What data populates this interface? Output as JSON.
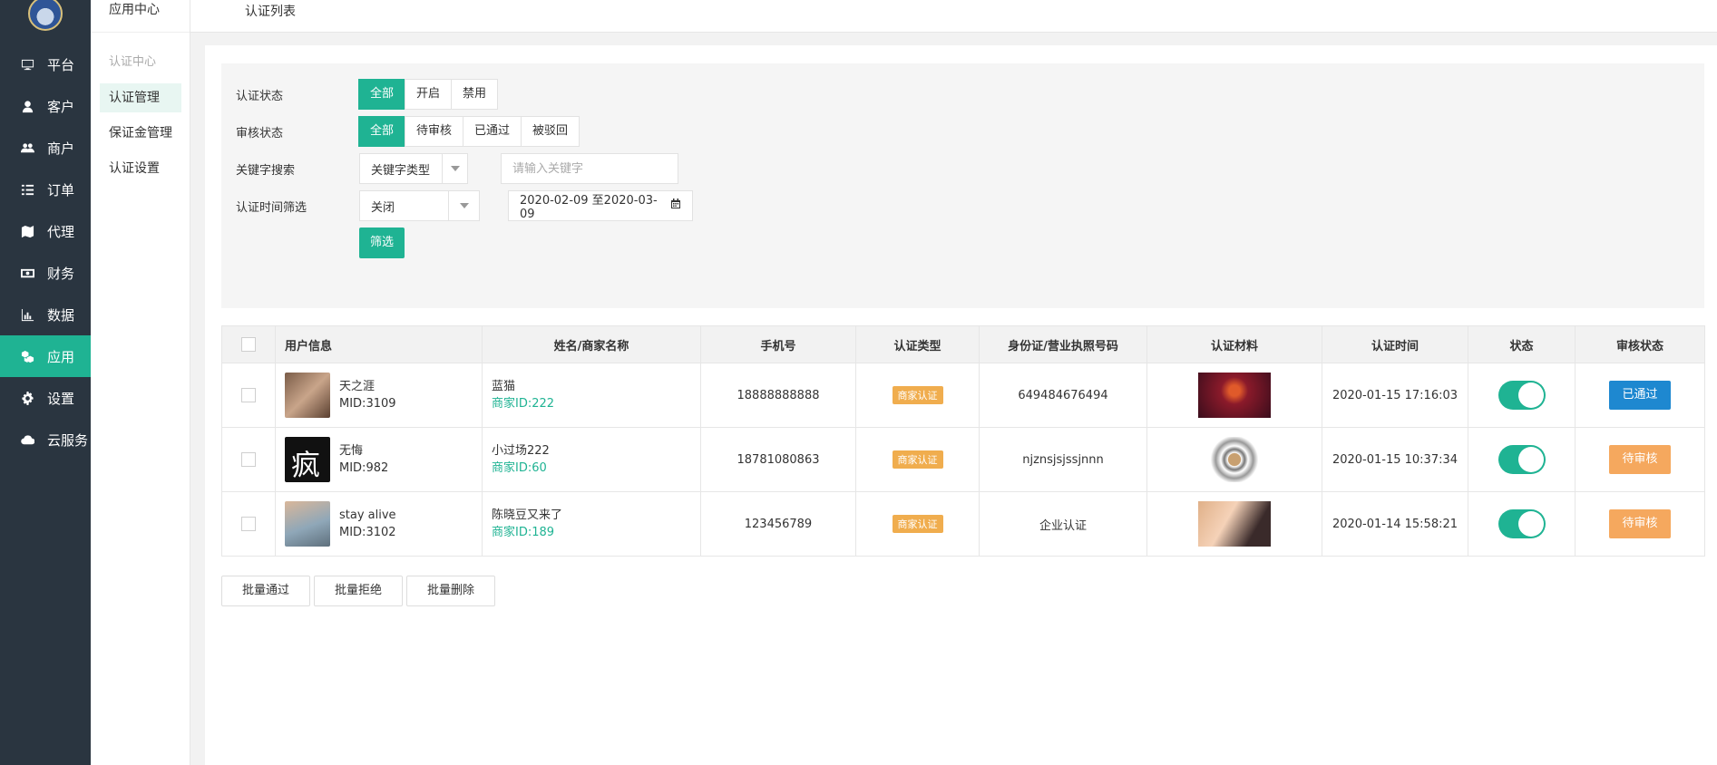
{
  "sidebar": {
    "items": [
      {
        "label": "平台",
        "icon": "monitor-icon"
      },
      {
        "label": "客户",
        "icon": "user-icon"
      },
      {
        "label": "商户",
        "icon": "users-icon"
      },
      {
        "label": "订单",
        "icon": "list-icon"
      },
      {
        "label": "代理",
        "icon": "map-icon"
      },
      {
        "label": "财务",
        "icon": "money-icon"
      },
      {
        "label": "数据",
        "icon": "bar-chart-icon"
      },
      {
        "label": "应用",
        "icon": "cubes-icon",
        "active": true
      },
      {
        "label": "设置",
        "icon": "gear-icon"
      },
      {
        "label": "云服务",
        "icon": "cloud-icon"
      }
    ]
  },
  "subnav": {
    "title": "应用中心",
    "group": "认证中心",
    "items": [
      "认证管理",
      "保证金管理",
      "认证设置"
    ]
  },
  "topbar": {
    "title": "认证列表"
  },
  "filters": {
    "status_label": "认证状态",
    "status_options": [
      "全部",
      "开启",
      "禁用"
    ],
    "review_label": "审核状态",
    "review_options": [
      "全部",
      "待审核",
      "已通过",
      "被驳回"
    ],
    "keyword_label": "关键字搜索",
    "keyword_type": "关键字类型",
    "keyword_placeholder": "请输入关键字",
    "time_label": "认证时间筛选",
    "time_select": "关闭",
    "date_range": "2020-02-09 至2020-03-09",
    "submit": "筛选"
  },
  "table": {
    "headers": [
      "用户信息",
      "姓名/商家名称",
      "手机号",
      "认证类型",
      "身份证/营业执照号码",
      "认证材料",
      "认证时间",
      "状态",
      "审核状态"
    ],
    "rows": [
      {
        "user": "天之涯",
        "mid": "MID:3109",
        "name": "蓝猫",
        "merchant": "商家ID:222",
        "phone": "18888888888",
        "type": "商家认证",
        "idno": "649484676494",
        "time": "2020-01-15 17:16:03",
        "review": "已通过",
        "review_state": "pass"
      },
      {
        "user": "无悔",
        "mid": "MID:982",
        "name": "小过场222",
        "merchant": "商家ID:60",
        "phone": "18781080863",
        "type": "商家认证",
        "idno": "njznsjsjssjnnn",
        "time": "2020-01-15 10:37:34",
        "review": "待审核",
        "review_state": "pend"
      },
      {
        "user": "stay alive",
        "mid": "MID:3102",
        "name": "陈晓豆又来了",
        "merchant": "商家ID:189",
        "phone": "123456789",
        "type": "商家认证",
        "idno": "企业认证",
        "time": "2020-01-14 15:58:21",
        "review": "待审核",
        "review_state": "pend"
      }
    ]
  },
  "bulk": [
    "批量通过",
    "批量拒绝",
    "批量删除"
  ],
  "colors": {
    "accent": "#1fb393",
    "sidebar": "#2a3540",
    "pass": "#1e88d0",
    "pending": "#f5a85e",
    "tag": "#f0ad4e"
  }
}
